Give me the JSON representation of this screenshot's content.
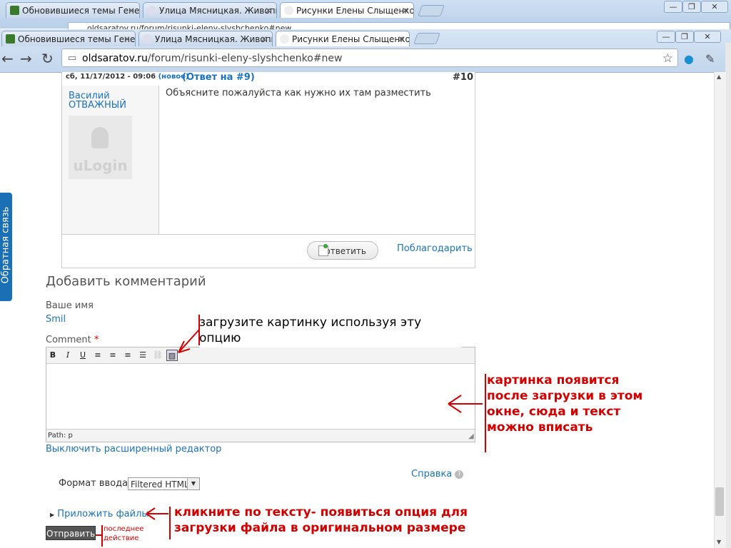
{
  "outer_tabs": [
    {
      "label": "Обновившиеся темы Генеал"
    },
    {
      "label": "Улица Мясницкая. Живопис"
    },
    {
      "label": "Рисунки Елены Слыщенко |"
    }
  ],
  "outer_url": "oldsaratov.ru/forum/risunki-eleny-slyshchenko#new",
  "inner_tabs": [
    {
      "label": "Обновившиеся темы Генеал"
    },
    {
      "label": "Улица Мясницкая. Живопис"
    },
    {
      "label": "Рисунки Елены Слыщенко |"
    }
  ],
  "address": {
    "host": "oldsaratov.ru",
    "path": "/forum/risunki-eleny-slyshchenko#new"
  },
  "feedback_label": "Обратная связь",
  "comment": {
    "date": "сб, 11/17/2012 - 09:06",
    "new_badge": "(новое)",
    "reply_to": "(Ответ на #9)",
    "number": "#10",
    "author": "Василий ОТВАЖНЫЙ",
    "avatar_text": "uLogin",
    "text": "Объясните пожалуйста как нужно их там разместить",
    "reply_label": "ответить",
    "thanks_label": "Поблагодарить"
  },
  "form": {
    "title": "Добавить комментарий",
    "name_label": "Ваше имя",
    "name_value": "Smil",
    "comment_label": "Comment",
    "required_mark": "*",
    "toolbar": {
      "bold": "B",
      "italic": "I",
      "underline": "U"
    },
    "path_text": "Path: p",
    "disable_editor": "Выключить расширенный редактор",
    "help": "Справка",
    "help_icon": "?",
    "format_label": "Формат ввода",
    "format_value": "Filtered HTML",
    "attach": "Приложить файлы",
    "submit": "Отправить"
  },
  "annotations": {
    "upload": "загрузите картинку используя эту опцию",
    "editor": "картинка появится после загрузки в этом окне, сюда и текст можно вписать",
    "attach": "кликните по тексту- появиться опция для загрузки файла в оригинальном размере",
    "last": "последнее действие"
  },
  "colors": {
    "link": "#1a73c0",
    "annotation": "#d40000",
    "feedback": "#1a6fb5"
  }
}
